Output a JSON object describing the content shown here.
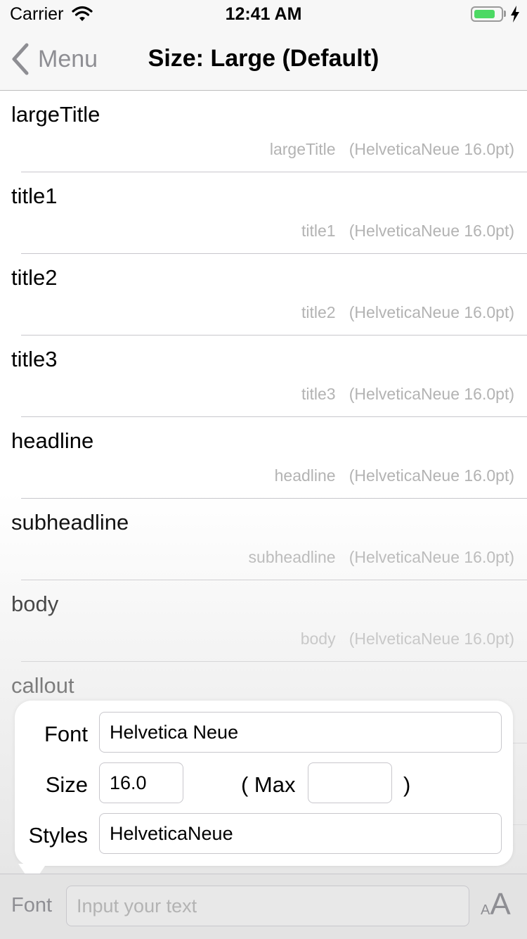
{
  "status_bar": {
    "carrier": "Carrier",
    "time": "12:41 AM",
    "battery_level": 0.8,
    "battery_color": "#4cd964"
  },
  "nav": {
    "back_label": "Menu",
    "title": "Size: Large (Default)"
  },
  "rows": [
    {
      "title": "largeTitle",
      "detail": "largeTitle   (HelveticaNeue 16.0pt)"
    },
    {
      "title": "title1",
      "detail": "title1   (HelveticaNeue 16.0pt)"
    },
    {
      "title": "title2",
      "detail": "title2   (HelveticaNeue 16.0pt)"
    },
    {
      "title": "title3",
      "detail": "title3   (HelveticaNeue 16.0pt)"
    },
    {
      "title": "headline",
      "detail": "headline   (HelveticaNeue 16.0pt)"
    },
    {
      "title": "subheadline",
      "detail": "subheadline   (HelveticaNeue 16.0pt)"
    },
    {
      "title": "body",
      "detail": "body   (HelveticaNeue 16.0pt)"
    },
    {
      "title": "callout",
      "detail": ""
    }
  ],
  "popup": {
    "font_label": "Font",
    "font_value": "Helvetica Neue",
    "size_label": "Size",
    "size_value": "16.0",
    "max_open": "( Max",
    "max_value": "",
    "max_close": ")",
    "styles_label": "Styles",
    "styles_value": "HelveticaNeue"
  },
  "toolbar": {
    "font_label": "Font",
    "input_placeholder": "Input your text",
    "aa_small": "A",
    "aa_big": "A"
  }
}
